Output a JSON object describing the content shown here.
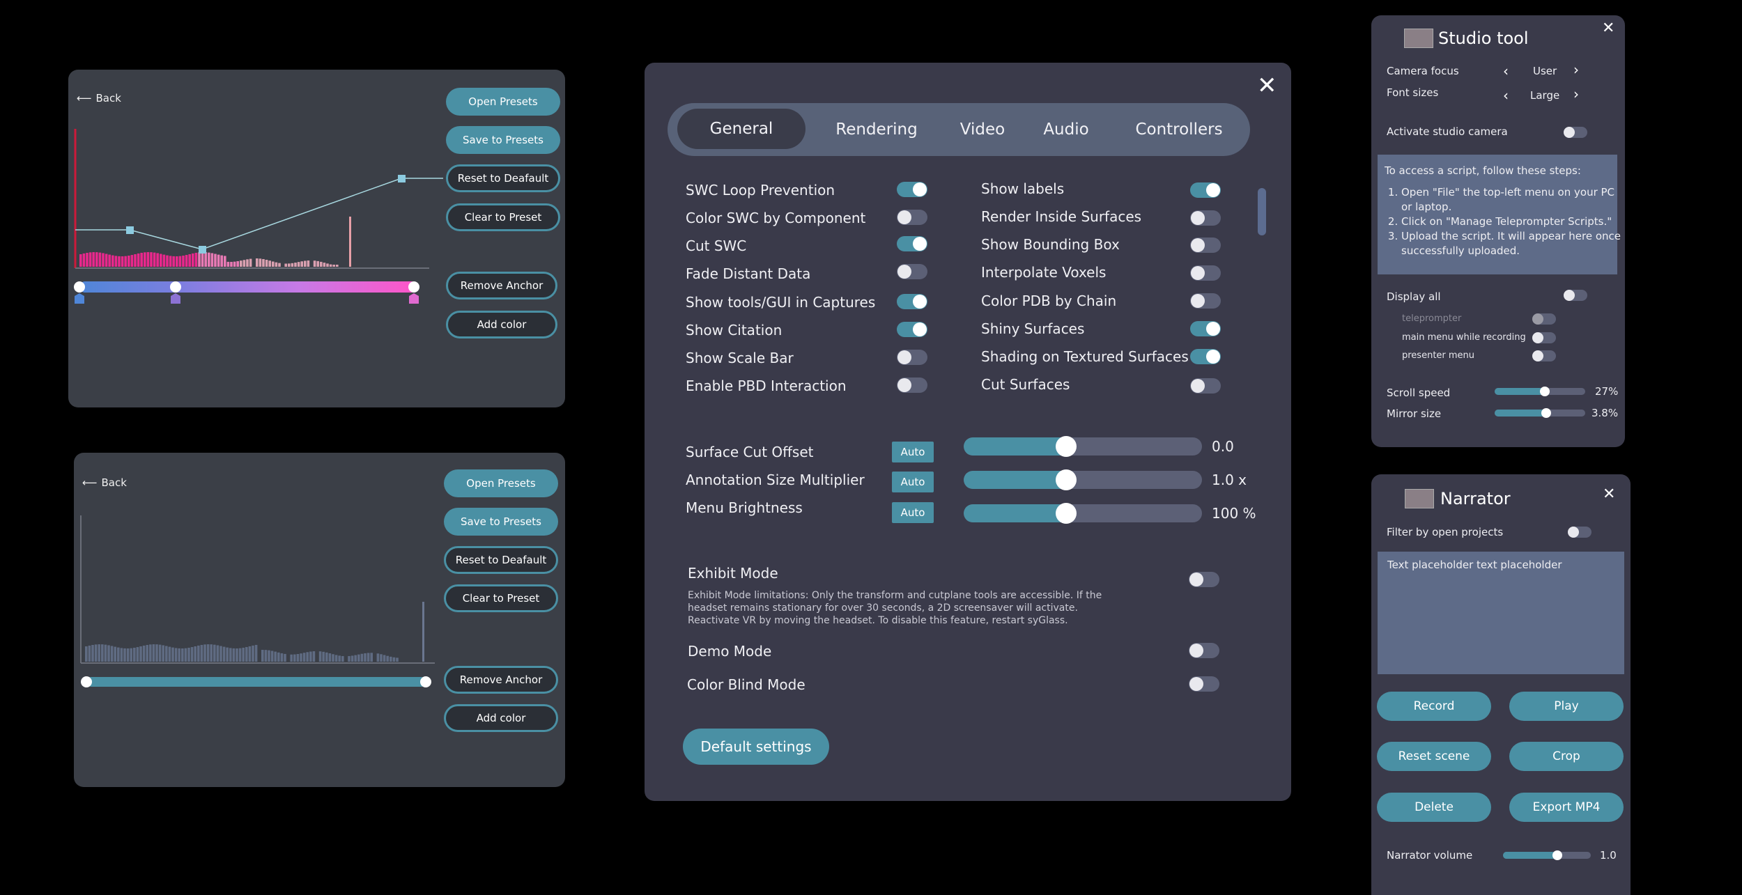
{
  "tf_panels": {
    "back_label": "Back",
    "open_presets": "Open Presets",
    "save_presets": "Save to Presets",
    "reset_default": "Reset to Deafault",
    "clear_preset": "Clear to Preset",
    "remove_anchor": "Remove Anchor",
    "add_color": "Add color"
  },
  "settings": {
    "tabs": [
      "General",
      "Rendering",
      "Video",
      "Audio",
      "Controllers"
    ],
    "left_toggles": [
      {
        "label": "SWC Loop Prevention",
        "on": true
      },
      {
        "label": "Color SWC by Component",
        "on": false
      },
      {
        "label": "Cut SWC",
        "on": true
      },
      {
        "label": "Fade Distant Data",
        "on": false
      },
      {
        "label": "Show tools/GUI in Captures",
        "on": true
      },
      {
        "label": "Show Citation",
        "on": true
      },
      {
        "label": "Show Scale Bar",
        "on": false
      },
      {
        "label": "Enable PBD Interaction",
        "on": false
      }
    ],
    "right_toggles": [
      {
        "label": "Show labels",
        "on": true
      },
      {
        "label": "Render Inside Surfaces",
        "on": false
      },
      {
        "label": "Show Bounding Box",
        "on": false
      },
      {
        "label": "Interpolate Voxels",
        "on": false
      },
      {
        "label": "Color PDB by Chain",
        "on": false
      },
      {
        "label": "Shiny Surfaces",
        "on": true
      },
      {
        "label": "Shading on Textured Surfaces",
        "on": true
      },
      {
        "label": "Cut Surfaces",
        "on": false
      }
    ],
    "sliders": [
      {
        "label": "Surface Cut Offset",
        "auto": "Auto",
        "value": "0.0",
        "fraction": 0.43
      },
      {
        "label": "Annotation Size Multiplier",
        "auto": "Auto",
        "value": "1.0 x",
        "fraction": 0.43
      },
      {
        "label": "Menu Brightness",
        "auto": "Auto",
        "value": "100 %",
        "fraction": 0.43
      }
    ],
    "exhibit_mode": {
      "label": "Exhibit Mode",
      "description": "Exhibit Mode limitations: Only the transform and cutplane tools are accessible. If the headset remains stationary for over 30 seconds, a 2D screensaver will activate. Reactivate VR by moving the headset. To disable this feature, restart syGlass."
    },
    "demo_mode": "Demo Mode",
    "color_blind_mode": "Color Blind Mode",
    "default_settings": "Default settings"
  },
  "studio": {
    "title": "Studio tool",
    "camera_focus_label": "Camera focus",
    "camera_focus_value": "User",
    "font_sizes_label": "Font sizes",
    "font_sizes_value": "Large",
    "activate_camera": "Activate studio camera",
    "instructions_intro": "To access a script, follow these steps:",
    "steps": [
      "Open \"File\" the top-left menu on your PC or laptop.",
      "Click on \"Manage Teleprompter Scripts.\"",
      "Upload the script. It will appear here once successfully uploaded."
    ],
    "display_all": "Display all",
    "sub_options": [
      "teleprompter",
      "main menu while recording",
      "presenter menu"
    ],
    "scroll_speed_label": "Scroll speed",
    "scroll_speed_value": "27%",
    "scroll_speed_fraction": 0.55,
    "mirror_size_label": "Mirror size",
    "mirror_size_value": "3.8%",
    "mirror_size_fraction": 0.57
  },
  "narrator": {
    "title": "Narrator",
    "filter_label": "Filter by open projects",
    "text_placeholder": "Text placeholder text placeholder",
    "buttons": [
      "Record",
      "Play",
      "Reset scene",
      "Crop",
      "Delete",
      "Export MP4"
    ],
    "volume_label": "Narrator volume",
    "volume_value": "1.0",
    "volume_fraction": 0.62
  },
  "colors": {
    "accent": "#4a90a4",
    "toggle_off": "#5c6076",
    "panel_dark": "#3a3a4a",
    "panel_grey": "#3b3f47"
  }
}
